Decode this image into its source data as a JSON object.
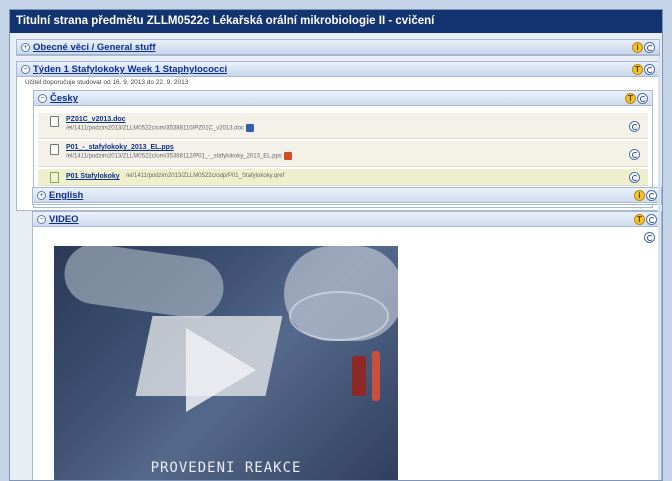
{
  "page": {
    "title": "Titulní strana předmětu ZLLM0522c Lékařská orální mikrobiologie II - cvičení"
  },
  "sections": {
    "general": {
      "label": "Obecné věci / General stuff"
    },
    "week1": {
      "label": "Týden 1 Stafylokoky Week 1 Staphylococci",
      "note": "Učitel doporučuje studovat od 16. 9. 2013 do 22. 9. 2013"
    },
    "cesky": {
      "label": "Česky"
    },
    "english": {
      "label": "English"
    },
    "video": {
      "label": "VIDEO",
      "caption": "PROVEDENI REAKCE"
    }
  },
  "files": [
    {
      "name": "PZ01C_v2013.doc",
      "path": "/el/1411/podzim2013/ZLLM0522c/um/35388110/PZ01C_v2013.doc"
    },
    {
      "name": "P01_-_stafylokoky_2013_EL.pps",
      "path": "/el/1411/podzim2013/ZLLM0522c/um/35388112/P01_-_stafylokoky_2013_EL.pps"
    },
    {
      "name": "P01 Stafylokoky",
      "path": "/el/1411/podzim2013/ZLLM0522c/odp/P01_Stafylokoky.qref"
    }
  ],
  "icons": {
    "info": "info-icon",
    "comment": "comment-icon",
    "toggle": "toggle-icon",
    "doc": "document-icon"
  },
  "colors": {
    "title_bar": "#133471",
    "link": "#0f2f8e",
    "section_header": "#c8d7ec"
  }
}
